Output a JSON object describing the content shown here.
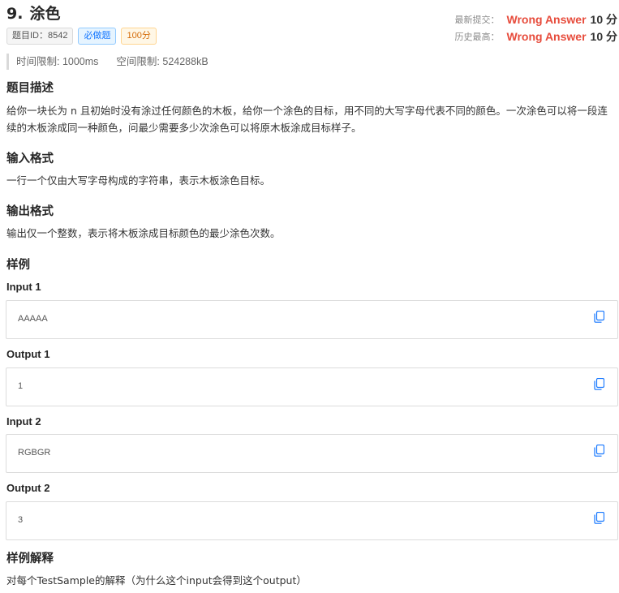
{
  "problem": {
    "number": "9.",
    "title": "涂色",
    "tags": [
      "题目ID：8542",
      "必做题",
      "100分"
    ]
  },
  "status": {
    "latest_label": "最新提交：",
    "latest_result": "Wrong Answer",
    "latest_score": "10 分",
    "history_label": "历史最高：",
    "history_result": "Wrong Answer",
    "history_score": "10 分"
  },
  "limits": {
    "time": "时间限制: 1000ms",
    "memory": "空间限制: 524288kB"
  },
  "description": {
    "heading": "题目描述",
    "text": "给你一块长为 n 且初始时没有涂过任何颜色的木板，给你一个涂色的目标，用不同的大写字母代表不同的颜色。一次涂色可以将一段连续的木板涂成同一种颜色，问最少需要多少次涂色可以将原木板涂成目标样子。"
  },
  "input_format": {
    "heading": "输入格式",
    "text": "一行一个仅由大写字母构成的字符串，表示木板涂色目标。"
  },
  "output_format": {
    "heading": "输出格式",
    "text": "输出仅一个整数，表示将木板涂成目标颜色的最少涂色次数。"
  },
  "samples": {
    "heading": "样例",
    "input1_label": "Input 1",
    "input1": "AAAAA",
    "output1_label": "Output 1",
    "output1": "1",
    "input2_label": "Input 2",
    "input2": "RGBGR",
    "output2_label": "Output 2",
    "output2": "3"
  },
  "explanation": {
    "heading": "样例解释",
    "text": "对每个TestSample的解释（为什么这个input会得到这个output）"
  },
  "colors": {
    "wrong_answer": "#e74c3c",
    "copy_icon": "#1677ff"
  }
}
